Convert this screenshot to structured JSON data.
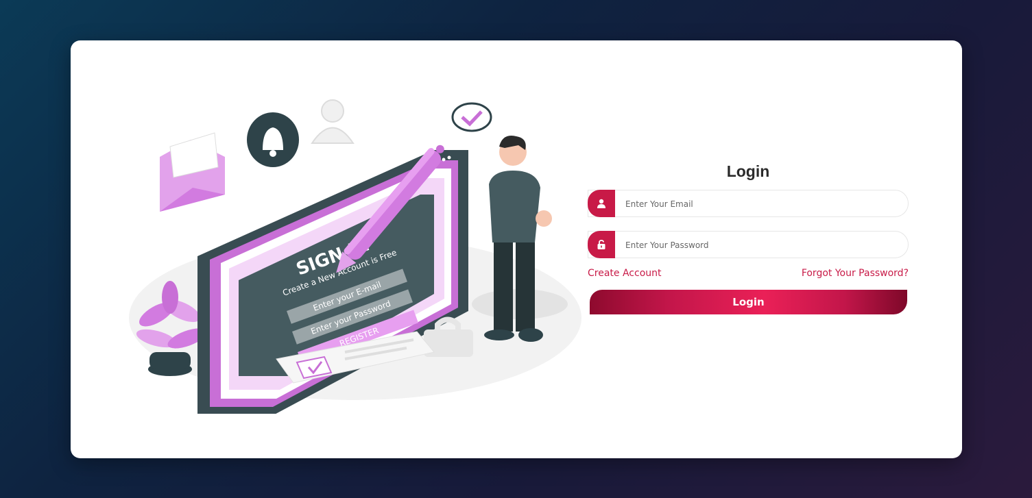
{
  "login": {
    "title": "Login",
    "email_placeholder": "Enter Your Email",
    "password_placeholder": "Enter Your Password",
    "create_account": "Create Account",
    "forgot_password": "Forgot Your Password?",
    "button_label": "Login"
  },
  "illustration": {
    "sign_up": "SIGN UP",
    "subtitle": "Create a New Account is Free",
    "email_field": "Enter your E-mail",
    "password_field": "Enter your Password",
    "register": "REGISTER"
  },
  "icons": {
    "user": "user-icon",
    "lock": "lock-icon"
  },
  "colors": {
    "accent": "#c81a47",
    "illustration_pink": "#c86fd6"
  }
}
